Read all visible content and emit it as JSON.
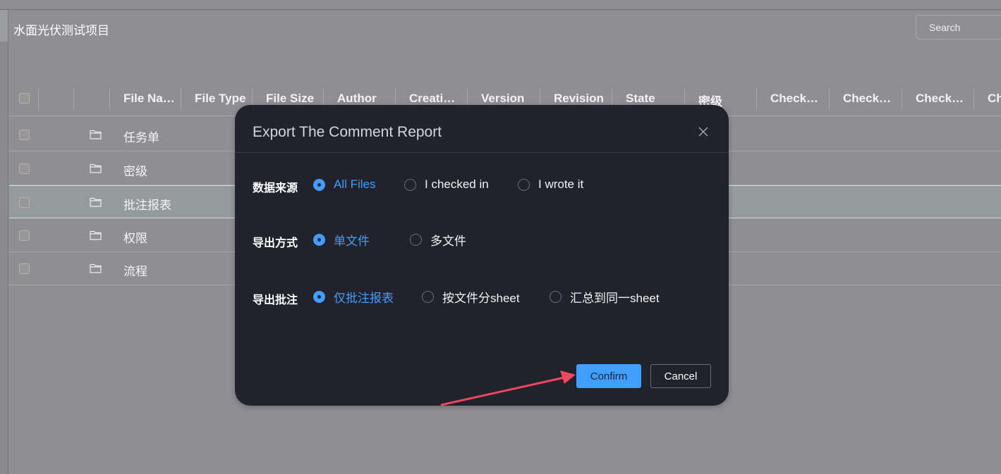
{
  "project_title": "水面光伏测试项目",
  "search": {
    "placeholder": "Search"
  },
  "table": {
    "columns": [
      "File Na…",
      "File Type",
      "File Size",
      "Author",
      "Creati…",
      "Version",
      "Revision",
      "State",
      "密级",
      "Check…",
      "Check…",
      "Check…",
      "Ch"
    ],
    "rows": [
      {
        "name": "任务单",
        "icon": "folder-icon"
      },
      {
        "name": "密级",
        "icon": "folder-icon"
      },
      {
        "name": "批注报表",
        "icon": "folder-icon",
        "highlighted": true
      },
      {
        "name": "权限",
        "icon": "folder-icon"
      },
      {
        "name": "流程",
        "icon": "folder-icon"
      }
    ]
  },
  "dialog": {
    "title": "Export The Comment Report",
    "fields": [
      {
        "label": "数据来源",
        "options": [
          "All Files",
          "I checked in",
          "I wrote it"
        ],
        "selected": "All Files"
      },
      {
        "label": "导出方式",
        "options": [
          "单文件",
          "多文件"
        ],
        "selected": "单文件"
      },
      {
        "label": "导出批注",
        "options": [
          "仅批注报表",
          "按文件分sheet",
          "汇总到同一sheet"
        ],
        "selected": "仅批注报表"
      }
    ],
    "confirm_label": "Confirm",
    "cancel_label": "Cancel"
  },
  "colors": {
    "accent": "#409eff",
    "dialog_bg": "#22222c",
    "overlay": "#8f8e93",
    "annotation_arrow": "#f0485e"
  }
}
